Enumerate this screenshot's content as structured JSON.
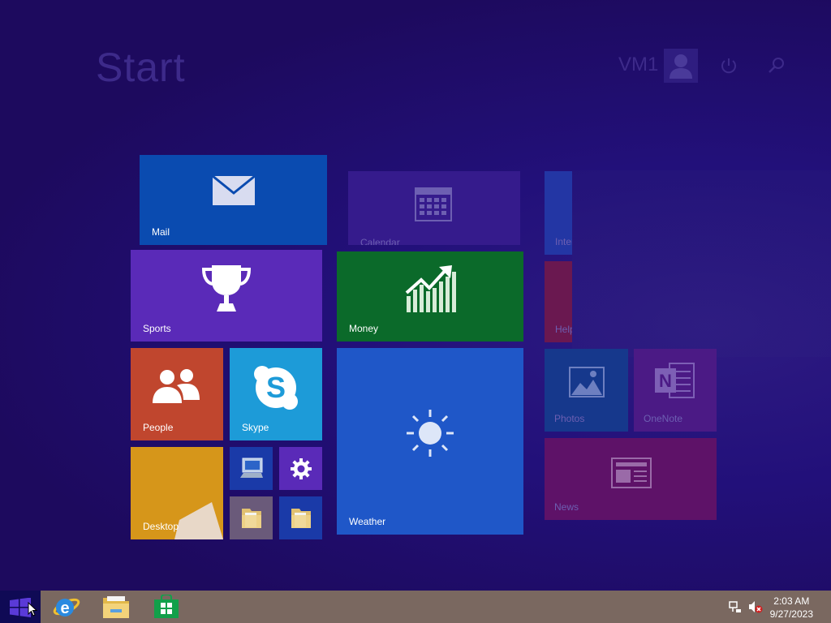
{
  "start": {
    "title": "Start",
    "user_name": "VM1"
  },
  "tiles": {
    "mail": {
      "label": "Mail",
      "color": "#0a4bb0"
    },
    "calendar": {
      "label": "Calendar",
      "color": "#351b8c"
    },
    "sports": {
      "label": "Sports",
      "color": "#5a2ab8"
    },
    "money": {
      "label": "Money",
      "color": "#0b6a2a"
    },
    "people": {
      "label": "People",
      "color": "#c0462e"
    },
    "skype": {
      "label": "Skype",
      "color": "#1d9bd8"
    },
    "weather": {
      "label": "Weather",
      "color": "#1f57c8"
    },
    "desktop": {
      "label": "Desktop",
      "color": "#d6961a"
    },
    "internet": {
      "label": "Inter",
      "color": "#2336a4"
    },
    "help": {
      "label": "Help",
      "color": "#6a1850"
    },
    "photos": {
      "label": "Photos",
      "color": "#16388c"
    },
    "onenote": {
      "label": "OneNote",
      "color": "#4b1a85"
    },
    "news": {
      "label": "News",
      "color": "#5e1268"
    }
  },
  "taskbar": {
    "apps": [
      "internet-explorer",
      "file-explorer",
      "store"
    ],
    "clock_time": "2:03 AM",
    "clock_date": "9/27/2023"
  }
}
